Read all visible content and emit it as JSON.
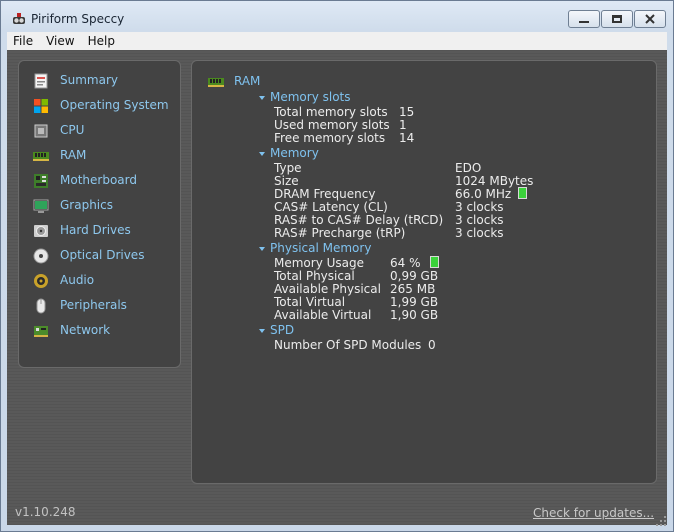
{
  "window": {
    "title": "Piriform Speccy"
  },
  "menu": [
    "File",
    "View",
    "Help"
  ],
  "sidebar": {
    "items": [
      {
        "label": "Summary",
        "icon": "summary-icon"
      },
      {
        "label": "Operating System",
        "icon": "windows-logo-icon"
      },
      {
        "label": "CPU",
        "icon": "cpu-icon"
      },
      {
        "label": "RAM",
        "icon": "ram-icon"
      },
      {
        "label": "Motherboard",
        "icon": "motherboard-icon"
      },
      {
        "label": "Graphics",
        "icon": "monitor-icon"
      },
      {
        "label": "Hard Drives",
        "icon": "hard-drive-icon"
      },
      {
        "label": "Optical Drives",
        "icon": "disc-icon"
      },
      {
        "label": "Audio",
        "icon": "speaker-icon"
      },
      {
        "label": "Peripherals",
        "icon": "mouse-icon"
      },
      {
        "label": "Network",
        "icon": "network-icon"
      }
    ]
  },
  "main": {
    "heading": "RAM",
    "memory_slots": {
      "title": "Memory slots",
      "rows": [
        {
          "label": "Total memory slots",
          "value": "15"
        },
        {
          "label": "Used memory slots",
          "value": "1"
        },
        {
          "label": "Free memory slots",
          "value": "14"
        }
      ]
    },
    "memory": {
      "title": "Memory",
      "rows": [
        {
          "label": "Type",
          "value": "EDO"
        },
        {
          "label": "Size",
          "value": "1024 MBytes"
        },
        {
          "label": "DRAM Frequency",
          "value": "66.0 MHz"
        },
        {
          "label": "CAS# Latency (CL)",
          "value": "3 clocks"
        },
        {
          "label": "RAS# to CAS# Delay (tRCD)",
          "value": "3 clocks"
        },
        {
          "label": "RAS# Precharge (tRP)",
          "value": "3 clocks"
        }
      ]
    },
    "physical_memory": {
      "title": "Physical Memory",
      "rows": [
        {
          "label": "Memory Usage",
          "value": "64 %"
        },
        {
          "label": "Total Physical",
          "value": "0,99 GB"
        },
        {
          "label": "Available Physical",
          "value": "265 MB"
        },
        {
          "label": "Total Virtual",
          "value": "1,99 GB"
        },
        {
          "label": "Available Virtual",
          "value": "1,90 GB"
        }
      ]
    },
    "spd": {
      "title": "SPD",
      "rows": [
        {
          "label": "Number Of SPD Modules",
          "value": "0"
        }
      ]
    }
  },
  "footer": {
    "version": "v1.10.248",
    "update_link": "Check for updates..."
  },
  "colors": {
    "accent": "#7fc2ef",
    "panel_bg": "#434343",
    "client_bg": "#595959",
    "indicator": "#3bd23b"
  }
}
